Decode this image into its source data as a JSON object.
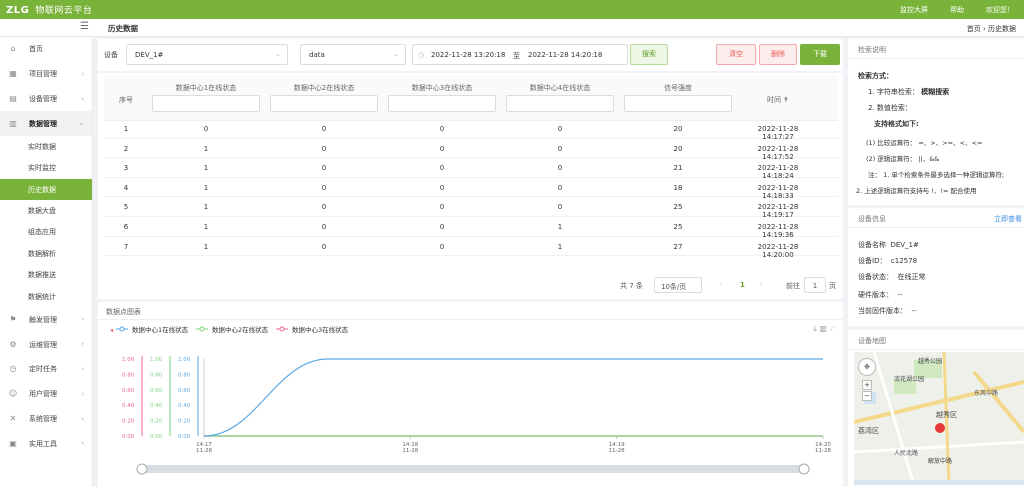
{
  "app": {
    "logo": "ZLG",
    "name": "物联网云平台"
  },
  "topnav": [
    "监控大屏",
    "帮助",
    "欢迎您！"
  ],
  "page": {
    "title": "历史数据",
    "breadcrumb": "首页  ›  历史数据"
  },
  "menu": [
    {
      "icon": "home-icon",
      "glyph": "⌂",
      "label": "首页"
    },
    {
      "icon": "project-icon",
      "glyph": "▦",
      "label": "项目管理",
      "arrow": "›"
    },
    {
      "icon": "device-icon",
      "glyph": "▤",
      "label": "设备管理",
      "arrow": "›"
    },
    {
      "icon": "data-icon",
      "glyph": "▥",
      "label": "数据管理",
      "arrow": "⌄",
      "expanded": true
    }
  ],
  "submenu": [
    "实时数据",
    "实时监控",
    "历史数据",
    "数据大盘",
    "组态应用",
    "数据解析",
    "数据推送",
    "数据统计"
  ],
  "menu2": [
    {
      "icon": "trigger-icon",
      "glyph": "⚑",
      "label": "触发管理"
    },
    {
      "icon": "ops-icon",
      "glyph": "⚙",
      "label": "运维管理"
    },
    {
      "icon": "task-icon",
      "glyph": "◷",
      "label": "定时任务"
    },
    {
      "icon": "user-icon",
      "glyph": "☺",
      "label": "用户管理"
    },
    {
      "icon": "system-icon",
      "glyph": "✕",
      "label": "系统管理"
    },
    {
      "icon": "tools-icon",
      "glyph": "▣",
      "label": "实用工具"
    }
  ],
  "filter": {
    "device_label": "设备",
    "device": "DEV_1#",
    "datatype": "data",
    "start": "2022-11-28 13:20:18",
    "to": "至",
    "end": "2022-11-28 14:20:18",
    "search": "搜索",
    "clear": "清空",
    "delete": "删除",
    "download": "下载"
  },
  "table": {
    "headers": [
      "序号",
      "数据中心1在线状态",
      "数据中心2在线状态",
      "数据中心3在线状态",
      "数据中心4在线状态",
      "信号强度",
      "时间 ↟"
    ],
    "rows": [
      [
        "1",
        "0",
        "0",
        "0",
        "0",
        "20",
        "2022-11-28 14:17:27"
      ],
      [
        "2",
        "1",
        "0",
        "0",
        "0",
        "20",
        "2022-11-28 14:17:52"
      ],
      [
        "3",
        "1",
        "0",
        "0",
        "0",
        "21",
        "2022-11-28 14:18:24"
      ],
      [
        "4",
        "1",
        "0",
        "0",
        "0",
        "18",
        "2022-11-28 14:18:33"
      ],
      [
        "5",
        "1",
        "0",
        "0",
        "0",
        "25",
        "2022-11-28 14:19:17"
      ],
      [
        "6",
        "1",
        "0",
        "0",
        "1",
        "25",
        "2022-11-28 14:19:36"
      ],
      [
        "7",
        "1",
        "0",
        "0",
        "1",
        "27",
        "2022-11-28 14:20:00"
      ]
    ]
  },
  "pager": {
    "total": "共 7 条",
    "size": "10条/页",
    "prev": "‹",
    "page": "1",
    "next": "›",
    "goto": "前往",
    "page_input": "1",
    "page_unit": "页"
  },
  "chart_panel": {
    "title": "数据点图表",
    "legend": [
      "数据中心1在线状态",
      "数据中心2在线状态",
      "数据中心3在线状态"
    ],
    "colors": [
      "#5aa9e6",
      "#7ed37e",
      "#f06292"
    ]
  },
  "chart_data": {
    "type": "line",
    "x_ticks": [
      "14:17\n11-28",
      "14:18\n11-28",
      "14:19\n11-28",
      "14:20\n11-28"
    ],
    "y_ticks": [
      "1.00",
      "0.80",
      "0.60",
      "0.40",
      "0.20",
      "0.00"
    ],
    "ylim": [
      0,
      1
    ],
    "series": [
      {
        "name": "数据中心1在线状态",
        "x": [
          0,
          0.1,
          0.3,
          1,
          3
        ],
        "values": [
          0,
          0.05,
          0.5,
          1,
          1
        ]
      },
      {
        "name": "数据中心2在线状态",
        "x": [
          0,
          3
        ],
        "values": [
          0,
          0
        ]
      },
      {
        "name": "数据中心3在线状态",
        "x": [
          0,
          3
        ],
        "values": [
          0,
          0
        ]
      }
    ]
  },
  "search_help": {
    "title": "检索说明",
    "heading": "检索方式：",
    "l1": "1. 字符串检索：",
    "l1b": "模糊搜索",
    "l2": "2. 数值检索：",
    "l3": "支持格式如下:",
    "l4": "(1) 比较运算符：    =、>、>=、<、<=",
    "l5": "(2) 逻辑运算符：    ||、&&",
    "l6": "注：  1. 单个检索条件最多选择一种逻辑运算符;",
    "l7": "2. 上述逻辑运算符支持与 !、!= 配合使用"
  },
  "device_info": {
    "title": "设备信息",
    "link": "立即查看",
    "name_label": "设备名称",
    "name": "DEV_1#",
    "id_label": "设备ID：",
    "id": "c12578",
    "status_label": "设备状态：",
    "status": "在线正常",
    "hw_label": "硬件版本：",
    "hw": "--",
    "fw_label": "当前固件版本：",
    "fw": "--"
  },
  "map": {
    "title": "设备地图",
    "labels": [
      "流花湖公园",
      "越秀公园",
      "越秀区",
      "荔湾区",
      "解放中路",
      "东风中路",
      "人民北路"
    ]
  }
}
